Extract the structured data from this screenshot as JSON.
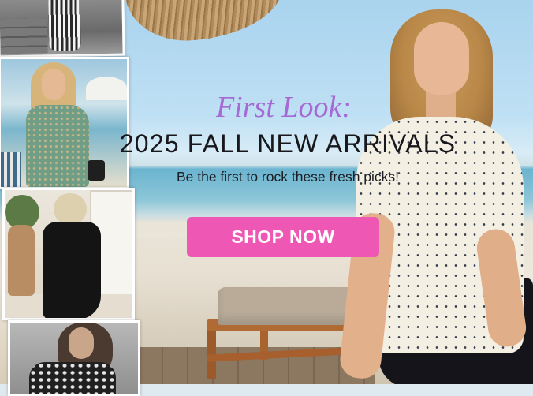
{
  "banner": {
    "kicker": "First Look:",
    "headline": "2025 FALL NEW ARRIVALS",
    "subline": "Be the first to rock these fresh picks!",
    "cta_label": "SHOP NOW"
  },
  "colors": {
    "kicker": "#a56ad4",
    "headline": "#17171c",
    "cta_background": "#ee58b4",
    "cta_text": "#ffffff"
  },
  "thumbnails": [
    {
      "subject": "striped-dress-photo"
    },
    {
      "subject": "green-print-blouse-photo"
    },
    {
      "subject": "black-dress-photo"
    },
    {
      "subject": "black-white-print-top-photo"
    }
  ]
}
